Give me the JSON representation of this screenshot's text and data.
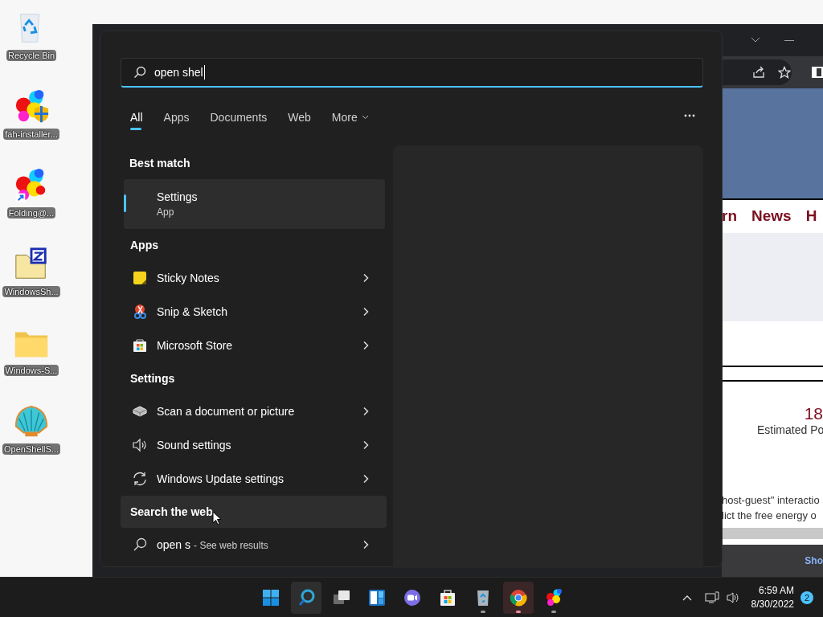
{
  "desktop_icons": [
    {
      "label": "Recycle Bin",
      "kind": "recycle"
    },
    {
      "label": "fah-installer...",
      "kind": "molecule-shield"
    },
    {
      "label": "Folding@...",
      "kind": "molecule-shortcut"
    },
    {
      "label": "WindowsSh...",
      "kind": "zip-folder"
    },
    {
      "label": "Windows-S...",
      "kind": "folder"
    },
    {
      "label": "OpenShellS...",
      "kind": "shell"
    }
  ],
  "browser": {
    "nav_items": [
      "rn",
      "News",
      "H"
    ],
    "stat_value": "18",
    "stat_label": "Estimated Po",
    "paragraph_lines": [
      "host-guest\" interactio",
      "lict the free energy o"
    ],
    "footer_link": "Sho"
  },
  "search": {
    "query": "open shel",
    "tabs": [
      {
        "label": "All",
        "selected": true,
        "has_menu": false
      },
      {
        "label": "Apps",
        "selected": false,
        "has_menu": false
      },
      {
        "label": "Documents",
        "selected": false,
        "has_menu": false
      },
      {
        "label": "Web",
        "selected": false,
        "has_menu": false
      },
      {
        "label": "More",
        "selected": false,
        "has_menu": true
      }
    ],
    "best_match": {
      "heading": "Best match",
      "title": "Settings",
      "subtitle": "App",
      "selected": true
    },
    "sections": [
      {
        "heading": "Apps",
        "items": [
          {
            "label": "Sticky Notes",
            "kind": "sticky"
          },
          {
            "label": "Snip & Sketch",
            "kind": "snip"
          },
          {
            "label": "Microsoft Store",
            "kind": "store"
          }
        ]
      },
      {
        "heading": "Settings",
        "items": [
          {
            "label": "Scan a document or picture",
            "kind": "scanner"
          },
          {
            "label": "Sound settings",
            "kind": "speaker"
          },
          {
            "label": "Windows Update settings",
            "kind": "update"
          }
        ]
      }
    ],
    "web": {
      "heading": "Search the web",
      "hovered": true,
      "query": "open s",
      "hint": "- See web results"
    }
  },
  "taskbar": {
    "items": [
      {
        "kind": "start",
        "active": false,
        "running": false
      },
      {
        "kind": "search",
        "active": true,
        "running": false
      },
      {
        "kind": "task-view",
        "active": false,
        "running": false
      },
      {
        "kind": "widgets",
        "active": false,
        "running": false
      },
      {
        "kind": "chat",
        "active": false,
        "running": false
      },
      {
        "kind": "store",
        "active": false,
        "running": false
      },
      {
        "kind": "recycle",
        "active": false,
        "running": true
      },
      {
        "kind": "chrome",
        "active": true,
        "running": true
      },
      {
        "kind": "molecule",
        "active": false,
        "running": true
      }
    ],
    "time": "6:59 AM",
    "date": "8/30/2022",
    "notifications": "2"
  }
}
